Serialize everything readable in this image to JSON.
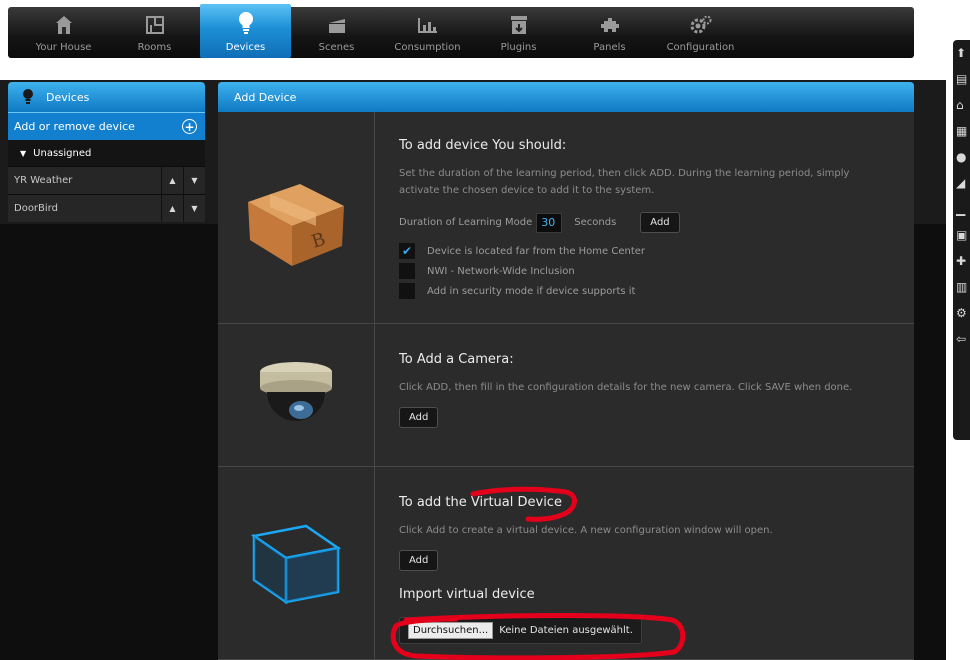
{
  "nav": {
    "items": [
      {
        "label": "Your House",
        "icon": "house-icon",
        "active": false
      },
      {
        "label": "Rooms",
        "icon": "rooms-icon",
        "active": false
      },
      {
        "label": "Devices",
        "icon": "bulb-icon",
        "active": true
      },
      {
        "label": "Scenes",
        "icon": "clapper-icon",
        "active": false
      },
      {
        "label": "Consumption",
        "icon": "chart-icon",
        "active": false
      },
      {
        "label": "Plugins",
        "icon": "plugin-box-icon",
        "active": false
      },
      {
        "label": "Panels",
        "icon": "panels-icon",
        "active": false
      },
      {
        "label": "Configuration",
        "icon": "gears-icon",
        "active": false
      }
    ]
  },
  "sidebar": {
    "title": "Devices",
    "add_remove_label": "Add or remove device",
    "group_label": "Unassigned",
    "devices": [
      {
        "name": "YR Weather"
      },
      {
        "name": "DoorBird"
      }
    ]
  },
  "main": {
    "header": "Add Device",
    "add_device": {
      "title": "To add device You should:",
      "description": "Set the duration of the learning period, then click ADD. During the learning period, simply activate the chosen device to add it to the system.",
      "duration_label": "Duration of Learning Mode",
      "duration_value": "30",
      "duration_unit": "Seconds",
      "add_label": "Add",
      "options": [
        {
          "label": "Device is located far from the Home Center",
          "checked": true
        },
        {
          "label": "NWI - Network-Wide Inclusion",
          "checked": false
        },
        {
          "label": "Add in security mode if device supports it",
          "checked": false
        }
      ]
    },
    "add_camera": {
      "title": "To Add a Camera:",
      "description": "Click ADD, then fill in the configuration details for the new camera. Click SAVE when done.",
      "add_label": "Add"
    },
    "virtual_device": {
      "title": "To add the Virtual Device",
      "description": "Click Add to create a virtual device. A new configuration window will open.",
      "add_label": "Add",
      "import_title": "Import virtual device",
      "browse_label": "Durchsuchen...",
      "no_file_label": "Keine Dateien ausgewählt."
    }
  },
  "colors": {
    "accent": "#1d8fd6",
    "annotation": "#e4001b"
  }
}
